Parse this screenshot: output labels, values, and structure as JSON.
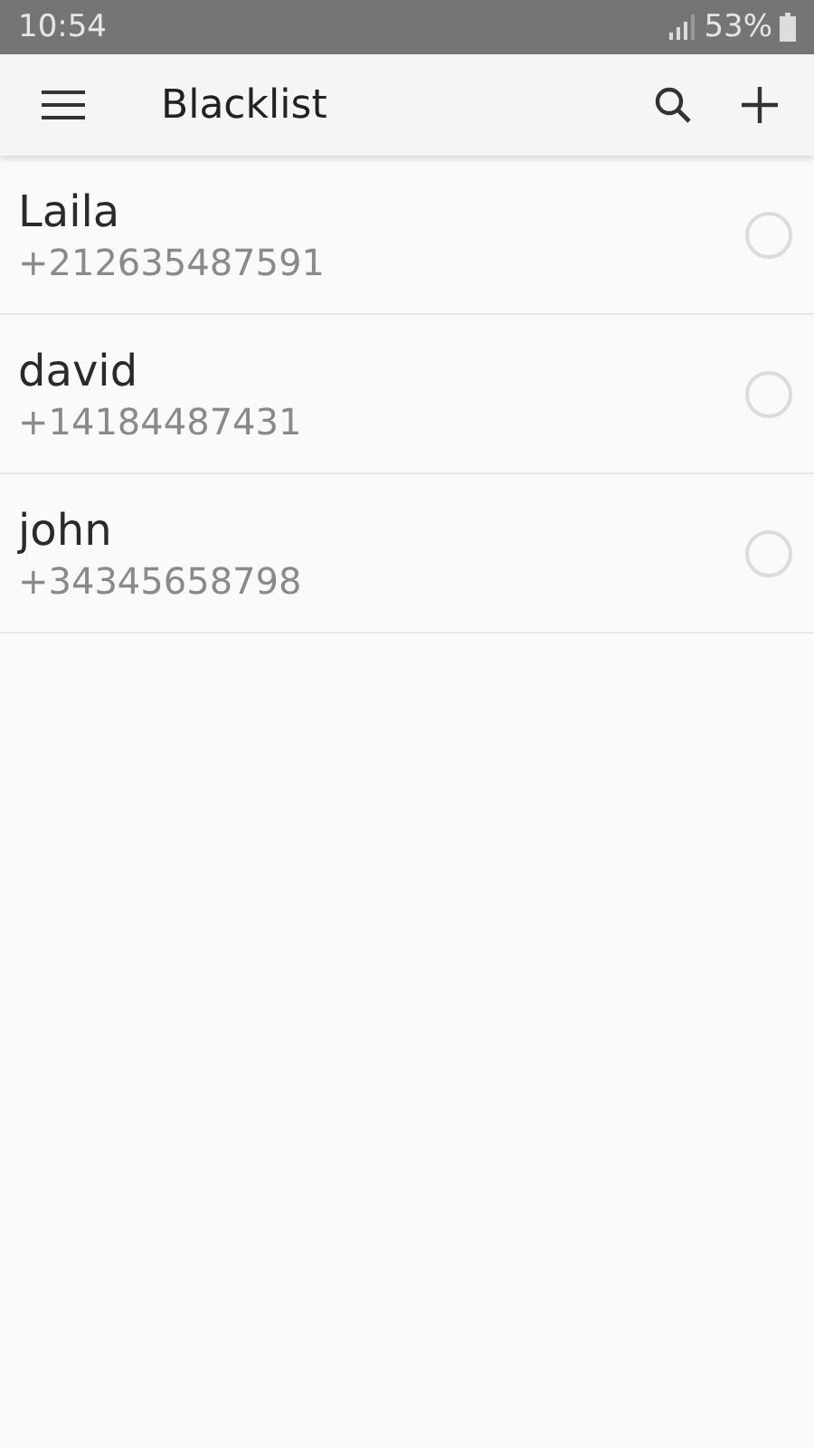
{
  "status_bar": {
    "time": "10:54",
    "battery": "53%"
  },
  "app_bar": {
    "title": "Blacklist"
  },
  "contacts": [
    {
      "name": "Laila",
      "number": "+212635487591",
      "selected": false
    },
    {
      "name": "david",
      "number": "+14184487431",
      "selected": false
    },
    {
      "name": "john",
      "number": "+34345658798",
      "selected": false
    }
  ]
}
